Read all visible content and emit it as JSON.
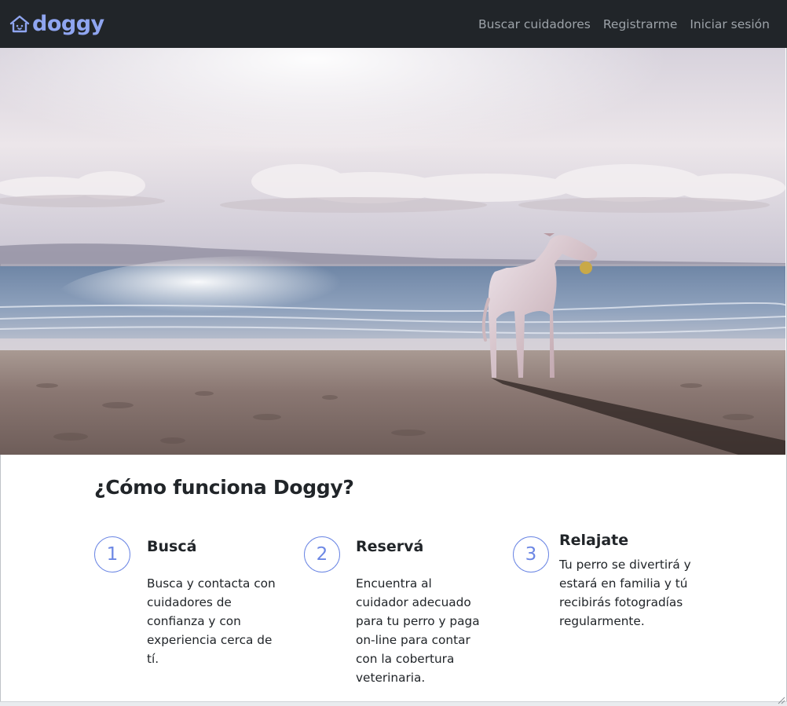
{
  "navbar": {
    "brand": "doggy",
    "links": [
      "Buscar cuidadores",
      "Registrarme",
      "Iniciar sesión"
    ]
  },
  "hero": {
    "image": "dog-on-beach-photo"
  },
  "how_it_works": {
    "title": "¿Cómo funciona Doggy?",
    "steps": [
      {
        "number": "1",
        "title": "Buscá",
        "body": "Busca y contacta con cuidadores de confianza y con experiencia cerca de tí."
      },
      {
        "number": "2",
        "title": "Reservá",
        "body": "Encuentra al cuidador adecuado para tu perro y paga on-line para contar con la cobertura veterinaria."
      },
      {
        "number": "3",
        "title": "Relajate",
        "body": "Tu perro se divertirá y estará en familia y tú recibirás fotogradías regularmente."
      }
    ]
  },
  "colors": {
    "navbar_bg": "#212529",
    "brand": "#8fa5f0",
    "accent": "#6c87e4",
    "nav_link": "#9da3a9",
    "text": "#212529"
  }
}
